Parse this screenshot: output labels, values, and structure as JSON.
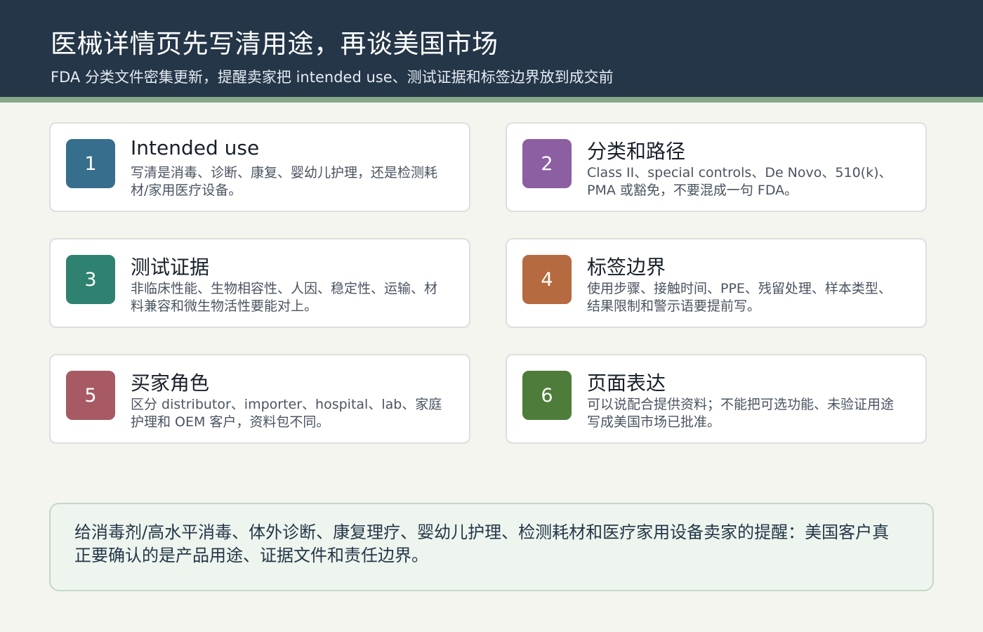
{
  "header": {
    "title": "医械详情页先写清用途，再谈美国市场",
    "subtitle": "FDA 分类文件密集更新，提醒卖家把 intended use、测试证据和标签边界放到成交前"
  },
  "cards": [
    {
      "number": "1",
      "title": "Intended use",
      "text": "写清是消毒、诊断、康复、婴幼儿护理，还是检测耗材/家用医疗设备。",
      "color": "#376e8e"
    },
    {
      "number": "2",
      "title": "分类和路径",
      "text": "Class II、special controls、De Novo、510(k)、PMA 或豁免，不要混成一句 FDA。",
      "color": "#8c5ea2"
    },
    {
      "number": "3",
      "title": "测试证据",
      "text": "非临床性能、生物相容性、人因、稳定性、运输、材料兼容和微生物活性要能对上。",
      "color": "#2f8270"
    },
    {
      "number": "4",
      "title": "标签边界",
      "text": "使用步骤、接触时间、PPE、残留处理、样本类型、结果限制和警示语要提前写。",
      "color": "#b56b3f"
    },
    {
      "number": "5",
      "title": "买家角色",
      "text": "区分 distributor、importer、hospital、lab、家庭护理和 OEM 客户，资料包不同。",
      "color": "#a75a64"
    },
    {
      "number": "6",
      "title": "页面表达",
      "text": "可以说配合提供资料；不能把可选功能、未验证用途写成美国市场已批准。",
      "color": "#4e7c3b"
    }
  ],
  "note": {
    "text": "给消毒剂/高水平消毒、体外诊断、康复理疗、婴幼儿护理、检测耗材和医疗家用设备卖家的提醒：美国客户真正要确认的是产品用途、证据文件和责任边界。"
  }
}
